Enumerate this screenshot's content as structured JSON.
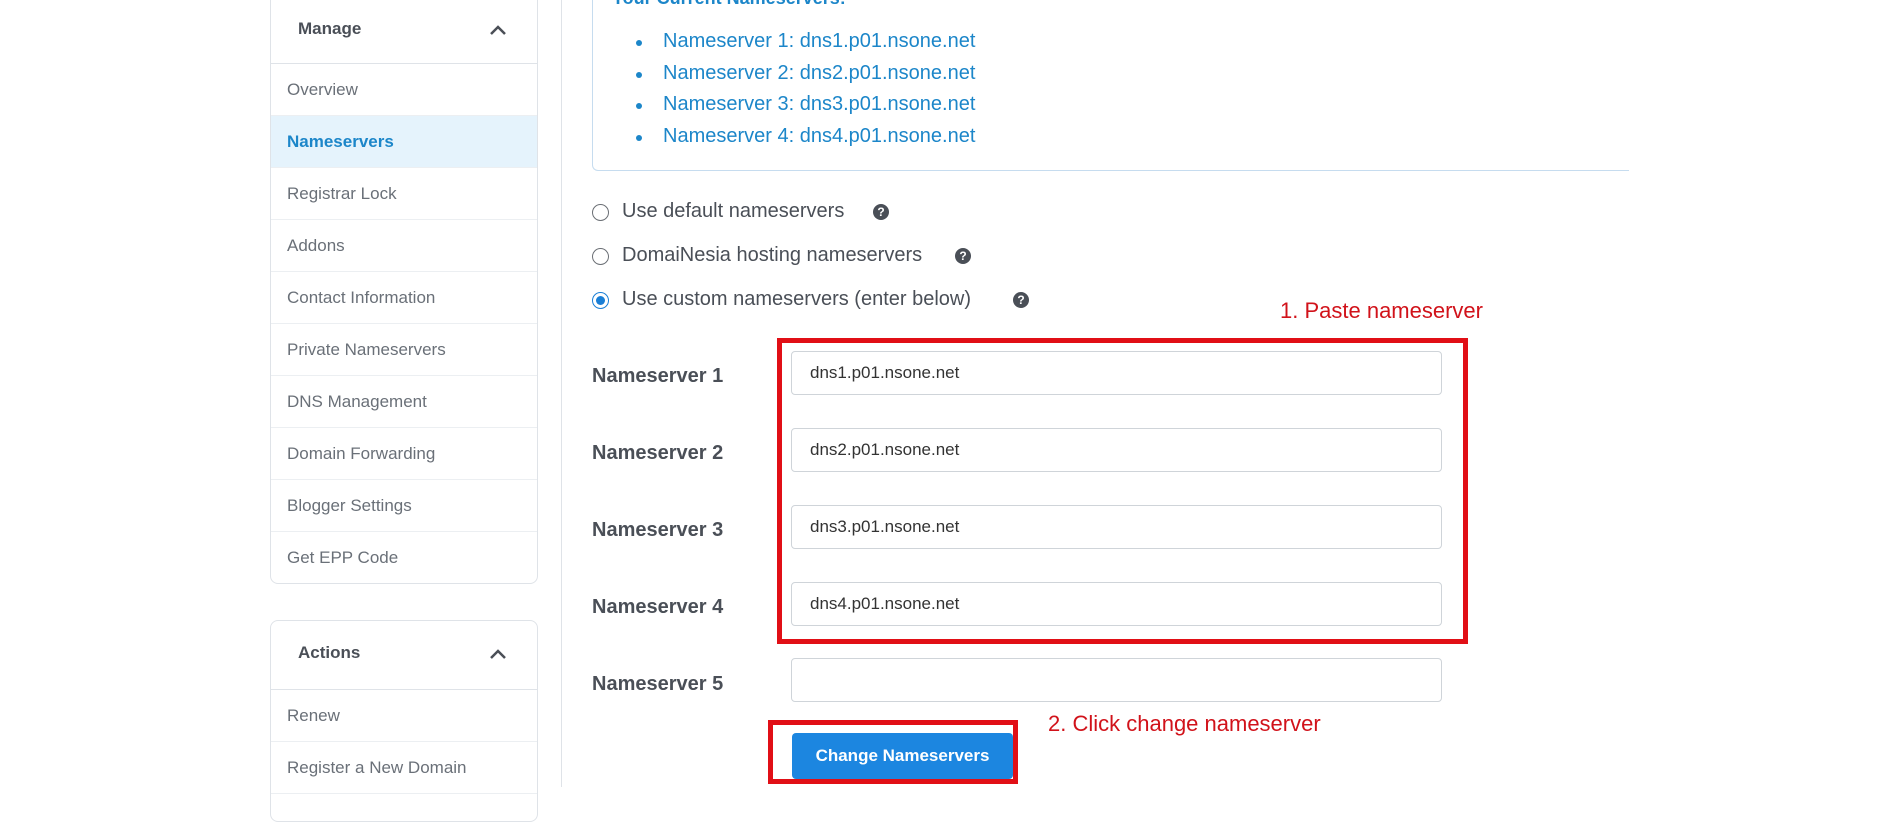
{
  "sidebar": {
    "manage": {
      "title": "Manage",
      "items": [
        {
          "label": "Overview"
        },
        {
          "label": "Nameservers"
        },
        {
          "label": "Registrar Lock"
        },
        {
          "label": "Addons"
        },
        {
          "label": "Contact Information"
        },
        {
          "label": "Private Nameservers"
        },
        {
          "label": "DNS Management"
        },
        {
          "label": "Domain Forwarding"
        },
        {
          "label": "Blogger Settings"
        },
        {
          "label": "Get EPP Code"
        }
      ]
    },
    "actions": {
      "title": "Actions",
      "items": [
        {
          "label": "Renew"
        },
        {
          "label": "Register a New Domain"
        }
      ]
    }
  },
  "current_nameservers": {
    "heading": "Your Current Nameservers:",
    "items": [
      "Nameserver 1: dns1.p01.nsone.net",
      "Nameserver 2: dns2.p01.nsone.net",
      "Nameserver 3: dns3.p01.nsone.net",
      "Nameserver 4: dns4.p01.nsone.net"
    ]
  },
  "options": [
    {
      "label": "Use default nameservers",
      "selected": false
    },
    {
      "label": "DomaiNesia hosting nameservers",
      "selected": false
    },
    {
      "label": "Use custom nameservers (enter below)",
      "selected": true
    }
  ],
  "help_glyph": "?",
  "fields": [
    {
      "label": "Nameserver 1",
      "value": "dns1.p01.nsone.net"
    },
    {
      "label": "Nameserver 2",
      "value": "dns2.p01.nsone.net"
    },
    {
      "label": "Nameserver 3",
      "value": "dns3.p01.nsone.net"
    },
    {
      "label": "Nameserver 4",
      "value": "dns4.p01.nsone.net"
    },
    {
      "label": "Nameserver 5",
      "value": ""
    }
  ],
  "submit_label": "Change Nameservers",
  "annotations": {
    "step1": "1. Paste nameserver",
    "step2": "2. Click change nameserver",
    "color": "#e10f16"
  },
  "colors": {
    "accent": "#1c86c9",
    "button": "#1c86e0",
    "active_bg": "#e5f3fc"
  }
}
